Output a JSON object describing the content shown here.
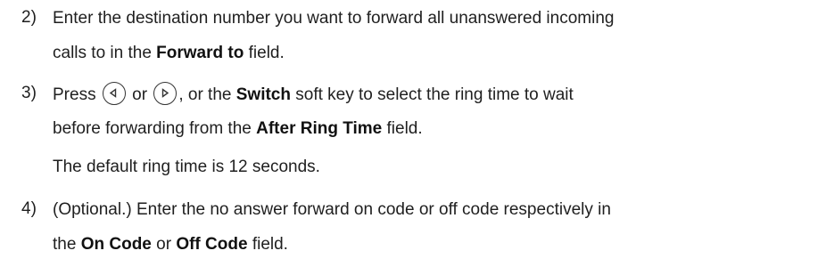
{
  "steps": [
    {
      "number": "2)",
      "lines": [
        [
          "Enter the destination number you want to forward all unanswered incoming"
        ],
        [
          "calls to in the ",
          "Forward to",
          " field."
        ]
      ]
    },
    {
      "number": "3)",
      "line1": {
        "press": "Press",
        "or": "or",
        "rest_a": ", or the ",
        "switch": "Switch",
        "rest_b": " soft key to select the ring time to wait"
      },
      "line2": {
        "a": "before forwarding from the ",
        "field": "After Ring Time",
        "b": " field."
      },
      "note": "The default ring time is 12 seconds."
    },
    {
      "number": "4)",
      "line1": "(Optional.) Enter the no answer forward on code or off code respectively in",
      "line2": {
        "a": "the ",
        "on": "On Code",
        "or": " or ",
        "off": "Off Code",
        "b": " field."
      }
    }
  ],
  "icons": {
    "left_key": "left-navigation-key-icon",
    "right_key": "right-navigation-key-icon"
  }
}
